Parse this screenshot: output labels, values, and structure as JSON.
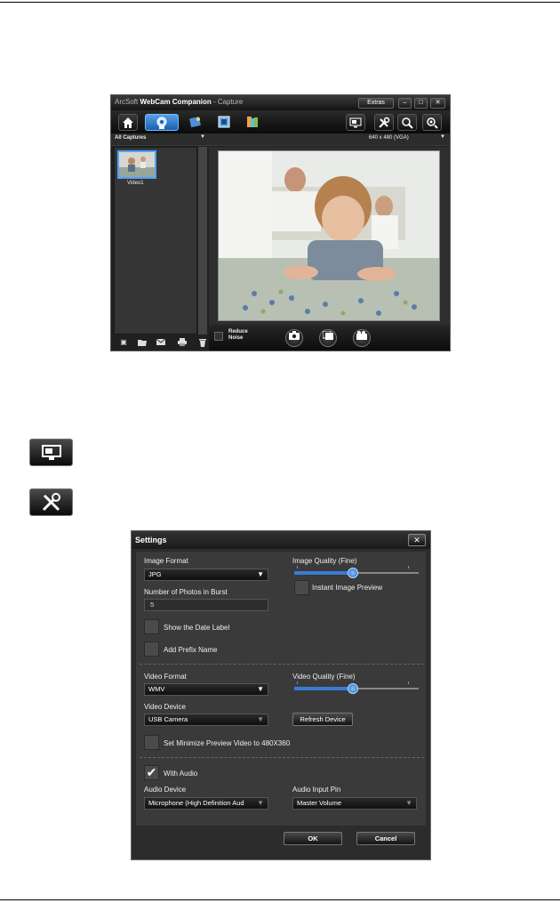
{
  "capture_window": {
    "title_brand": "ArcSoft",
    "title_app": "WebCam Companion",
    "title_suffix": "- Capture",
    "extras_label": "Extras",
    "min_glyph": "–",
    "max_glyph": "□",
    "close_glyph": "✕",
    "album_dropdown": "All Captures",
    "resolution_dropdown": "640 x 480 (VGA)",
    "thumbnail_label": "Video1",
    "reduce_noise_label": "Reduce Noise",
    "toolbar_icons": [
      "home-icon",
      "webcam-icon",
      "effects-icon",
      "frames-icon",
      "audio-icon",
      "display-icon",
      "settings-icon",
      "zoom-icon",
      "record-icon"
    ],
    "left_tools_icons": [
      "play-icon",
      "open-folder-icon",
      "email-icon",
      "print-icon",
      "delete-icon"
    ],
    "capture_controls_icons": [
      "camera-icon",
      "burst-icon",
      "video-icon"
    ]
  },
  "standalone_icons": {
    "display_icon": "display-icon",
    "settings_icon": "settings-icon"
  },
  "settings_dialog": {
    "title": "Settings",
    "close_glyph": "✕",
    "image_format_label": "Image Format",
    "image_format_value": "JPG",
    "image_quality_label": "Image Quality  (Fine)",
    "image_quality_level": 0.47,
    "instant_preview_label": "Instant Image Preview",
    "instant_preview_checked": false,
    "burst_label": "Number of Photos in Burst",
    "burst_value": "5",
    "show_date_label": "Show the Date Label",
    "show_date_checked": false,
    "add_prefix_label": "Add Prefix Name",
    "add_prefix_checked": false,
    "video_format_label": "Video Format",
    "video_format_value": "WMV",
    "video_quality_label": "Video Quality  (Fine)",
    "video_quality_level": 0.47,
    "video_device_label": "Video Device",
    "video_device_value": "USB Camera",
    "refresh_device_label": "Refresh Device",
    "minimize_preview_label": "Set Minimize Preview Video to 480X360",
    "minimize_preview_checked": false,
    "with_audio_label": "With Audio",
    "with_audio_checked": true,
    "audio_device_label": "Audio Device",
    "audio_device_value": "Microphone (High Definition Aud",
    "audio_input_pin_label": "Audio Input Pin",
    "audio_input_pin_value": "Master Volume",
    "ok_label": "OK",
    "cancel_label": "Cancel"
  }
}
